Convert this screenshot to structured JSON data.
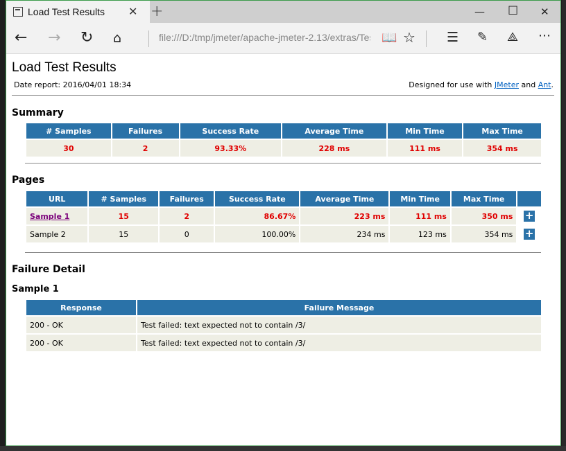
{
  "browser": {
    "tab_title": "Load Test Results",
    "address": "file:///D:/tmp/jmeter/apache-jmeter-2.13/extras/Test.h",
    "icons": [
      "page-icon",
      "close-icon",
      "plus-icon",
      "minimize-icon",
      "maximize-icon",
      "close-icon",
      "back-icon",
      "forward-icon",
      "refresh-icon",
      "home-icon",
      "reading-view-icon",
      "favorite-star-icon",
      "hub-icon",
      "web-note-icon",
      "share-icon",
      "more-icon"
    ]
  },
  "report": {
    "title": "Load Test Results",
    "date_label": "Date report: 2016/04/01 18:34",
    "designed_prefix": "Designed for use with ",
    "jmeter_link": "JMeter",
    "and_text": " and ",
    "ant_link": "Ant",
    "period": "."
  },
  "summary": {
    "heading": "Summary",
    "headers": [
      "# Samples",
      "Failures",
      "Success Rate",
      "Average Time",
      "Min Time",
      "Max Time"
    ],
    "row": [
      "30",
      "2",
      "93.33%",
      "228 ms",
      "111 ms",
      "354 ms"
    ]
  },
  "pages": {
    "heading": "Pages",
    "headers": [
      "URL",
      "# Samples",
      "Failures",
      "Success Rate",
      "Average Time",
      "Min Time",
      "Max Time"
    ],
    "rows": [
      [
        "Sample 1",
        "15",
        "2",
        "86.67%",
        "223 ms",
        "111 ms",
        "350 ms"
      ],
      [
        "Sample 2",
        "15",
        "0",
        "100.00%",
        "234 ms",
        "123 ms",
        "354 ms"
      ]
    ],
    "expand_glyph": "+"
  },
  "failure": {
    "heading": "Failure Detail",
    "sample_heading": "Sample 1",
    "headers": [
      "Response",
      "Failure Message"
    ],
    "rows": [
      [
        "200 - OK",
        "Test failed: text expected not to contain /3/"
      ],
      [
        "200 - OK",
        "Test failed: text expected not to contain /3/"
      ]
    ]
  },
  "colors": {
    "header_bg": "#2a72a8",
    "cell_bg": "#eeeee4",
    "fail_text": "#e00000",
    "link": "#0060c0",
    "visited_link": "#7a007a"
  }
}
